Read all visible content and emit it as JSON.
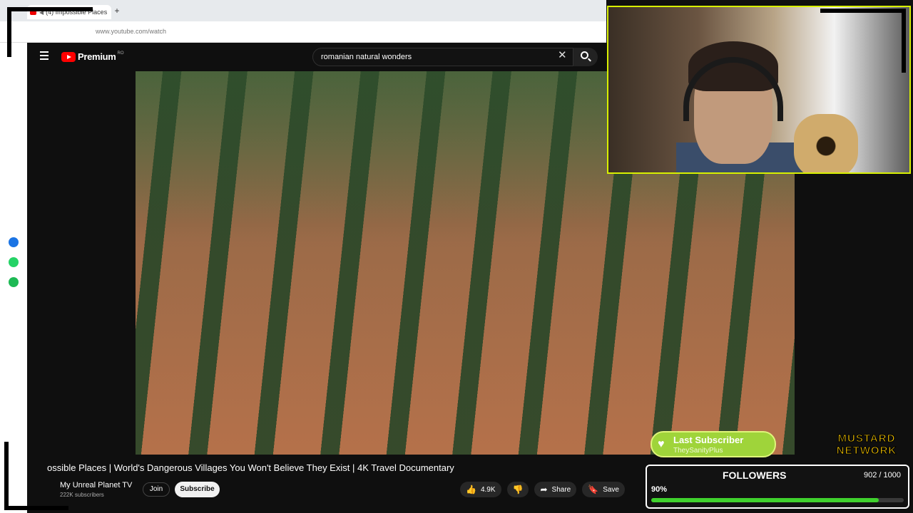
{
  "browser": {
    "tab_title": "(4) Impossible Places",
    "new_tab": "+",
    "url": "www.youtube.com/watch"
  },
  "youtube": {
    "brand": "Premium",
    "region": "RO",
    "search_query": "romanian natural wonders",
    "clear_symbol": "✕"
  },
  "video": {
    "title_prefix": "ossible Places",
    "title": "World's Dangerous Villages You Won't Believe They Exist",
    "title_suffix": "4K Travel Documentary",
    "channel": "My Unreal Planet TV",
    "subscribers": "222K subscribers",
    "join_label": "Join",
    "subscribe_label": "Subscribe",
    "likes": "4.9K",
    "share_label": "Share",
    "save_label": "Save"
  },
  "overlay": {
    "last_subscriber_heading": "Last Subscriber",
    "last_subscriber_name": "TheySanityPlus",
    "network_line1": "MUSTARD",
    "network_line2": "NETWORK",
    "followers_label": "FOLLOWERS",
    "followers_count": "902 / 1000",
    "followers_percent": "90%",
    "followers_progress": 0.902
  },
  "colors": {
    "accent_green": "#3fd12d",
    "webcam_border": "#d8f000",
    "youtube_red": "#ff0000",
    "mustard": "#f3c300"
  },
  "icons": [
    "search-icon",
    "menu-icon",
    "youtube-logo-icon",
    "like-icon",
    "dislike-icon",
    "share-icon",
    "save-icon",
    "heart-icon",
    "messenger-icon",
    "whatsapp-icon",
    "spotify-icon"
  ]
}
